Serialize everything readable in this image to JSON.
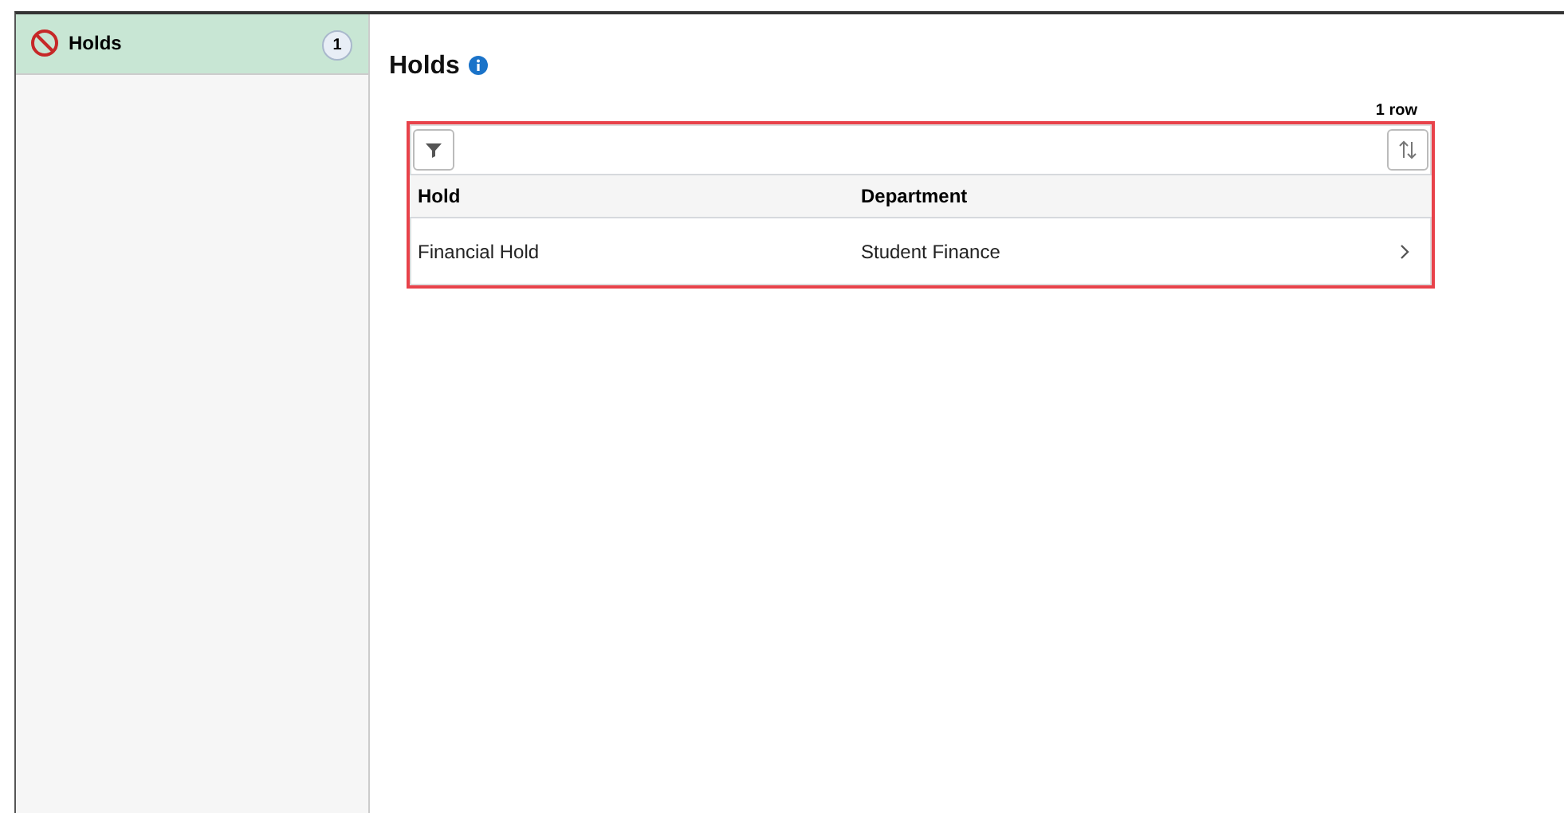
{
  "sidebar": {
    "items": [
      {
        "label": "Holds",
        "count": "1",
        "selected": true
      }
    ]
  },
  "page": {
    "title": "Holds",
    "row_count": "1 row"
  },
  "table": {
    "columns": [
      "Hold",
      "Department"
    ],
    "rows": [
      {
        "cells": [
          "Financial Hold",
          "Student Finance"
        ]
      }
    ]
  }
}
